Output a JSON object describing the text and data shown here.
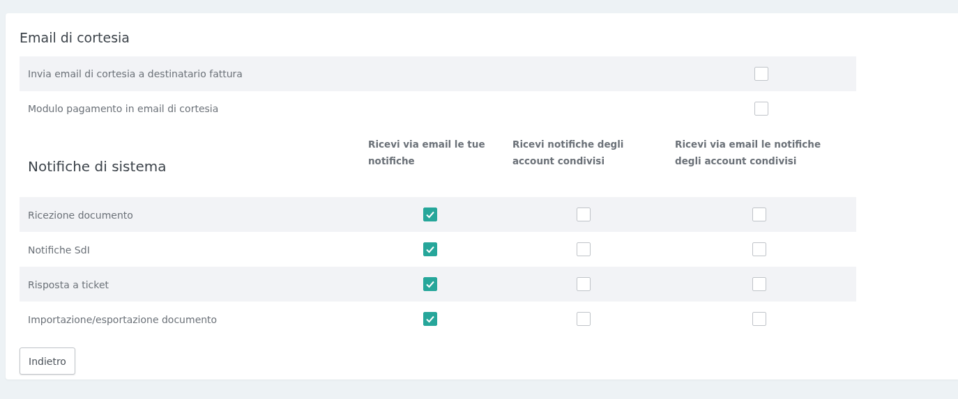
{
  "courtesy": {
    "title": "Email di cortesia",
    "rows": [
      {
        "label": "Invia email di cortesia a destinatario fattura",
        "checked": false
      },
      {
        "label": "Modulo pagamento in email di cortesia",
        "checked": false
      }
    ]
  },
  "notifications": {
    "title": "Notifiche di sistema",
    "columns": [
      "Ricevi via email le tue notifiche",
      "Ricevi notifiche degli account condivisi",
      "Ricevi via email le notifiche degli account condivisi"
    ],
    "rows": [
      {
        "label": "Ricezione documento",
        "checks": [
          {
            "checked": true
          },
          {
            "checked": false
          },
          {
            "checked": false
          }
        ]
      },
      {
        "label": "Notifiche SdI",
        "checks": [
          {
            "checked": true
          },
          {
            "checked": false
          },
          {
            "checked": false
          }
        ]
      },
      {
        "label": "Risposta a ticket",
        "checks": [
          {
            "checked": true
          },
          {
            "checked": false
          },
          {
            "checked": false
          }
        ]
      },
      {
        "label": "Importazione/esportazione documento",
        "checks": [
          {
            "checked": true
          },
          {
            "checked": false
          },
          {
            "checked": false
          }
        ]
      }
    ]
  },
  "buttons": [
    "Indietro"
  ]
}
